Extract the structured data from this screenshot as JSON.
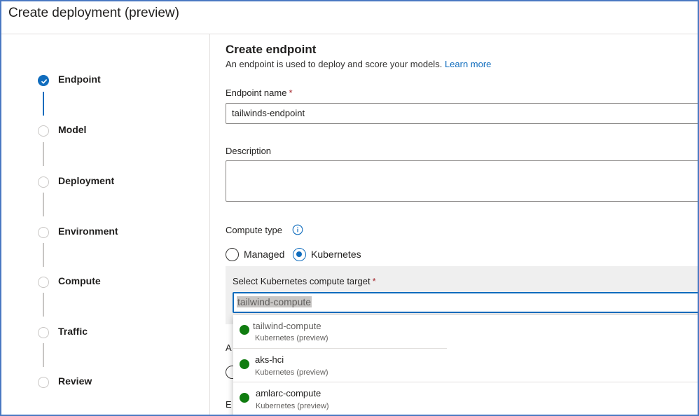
{
  "window": {
    "title": "Create deployment (preview)"
  },
  "steps": [
    {
      "label": "Endpoint",
      "state": "complete"
    },
    {
      "label": "Model",
      "state": "pending"
    },
    {
      "label": "Deployment",
      "state": "pending"
    },
    {
      "label": "Environment",
      "state": "pending"
    },
    {
      "label": "Compute",
      "state": "pending"
    },
    {
      "label": "Traffic",
      "state": "pending"
    },
    {
      "label": "Review",
      "state": "pending"
    }
  ],
  "form": {
    "section_title": "Create endpoint",
    "section_desc": "An endpoint is used to deploy and score your models.",
    "learn_more": "Learn more",
    "endpoint_name": {
      "label": "Endpoint name",
      "required": "*",
      "value": "tailwinds-endpoint"
    },
    "description": {
      "label": "Description",
      "value": ""
    },
    "compute_type": {
      "label": "Compute type",
      "info_icon": "info-icon",
      "options": [
        "Managed",
        "Kubernetes"
      ],
      "selected": "Kubernetes"
    },
    "compute_target": {
      "label": "Select Kubernetes compute target",
      "required": "*",
      "value": "tailwind-compute"
    },
    "hidden_labels": [
      "A",
      "E"
    ]
  },
  "dropdown": {
    "options": [
      {
        "name": "tailwind-compute",
        "type": "Kubernetes (preview)",
        "status": "running"
      },
      {
        "name": "aks-hci",
        "type": "Kubernetes (preview)",
        "status": "running"
      },
      {
        "name": "amlarc-compute",
        "type": "Kubernetes (preview)",
        "status": "running"
      }
    ]
  },
  "colors": {
    "accent": "#0f6cbd",
    "status_ok": "#107c10",
    "required": "#a4262c",
    "frame": "#4a78c2"
  }
}
